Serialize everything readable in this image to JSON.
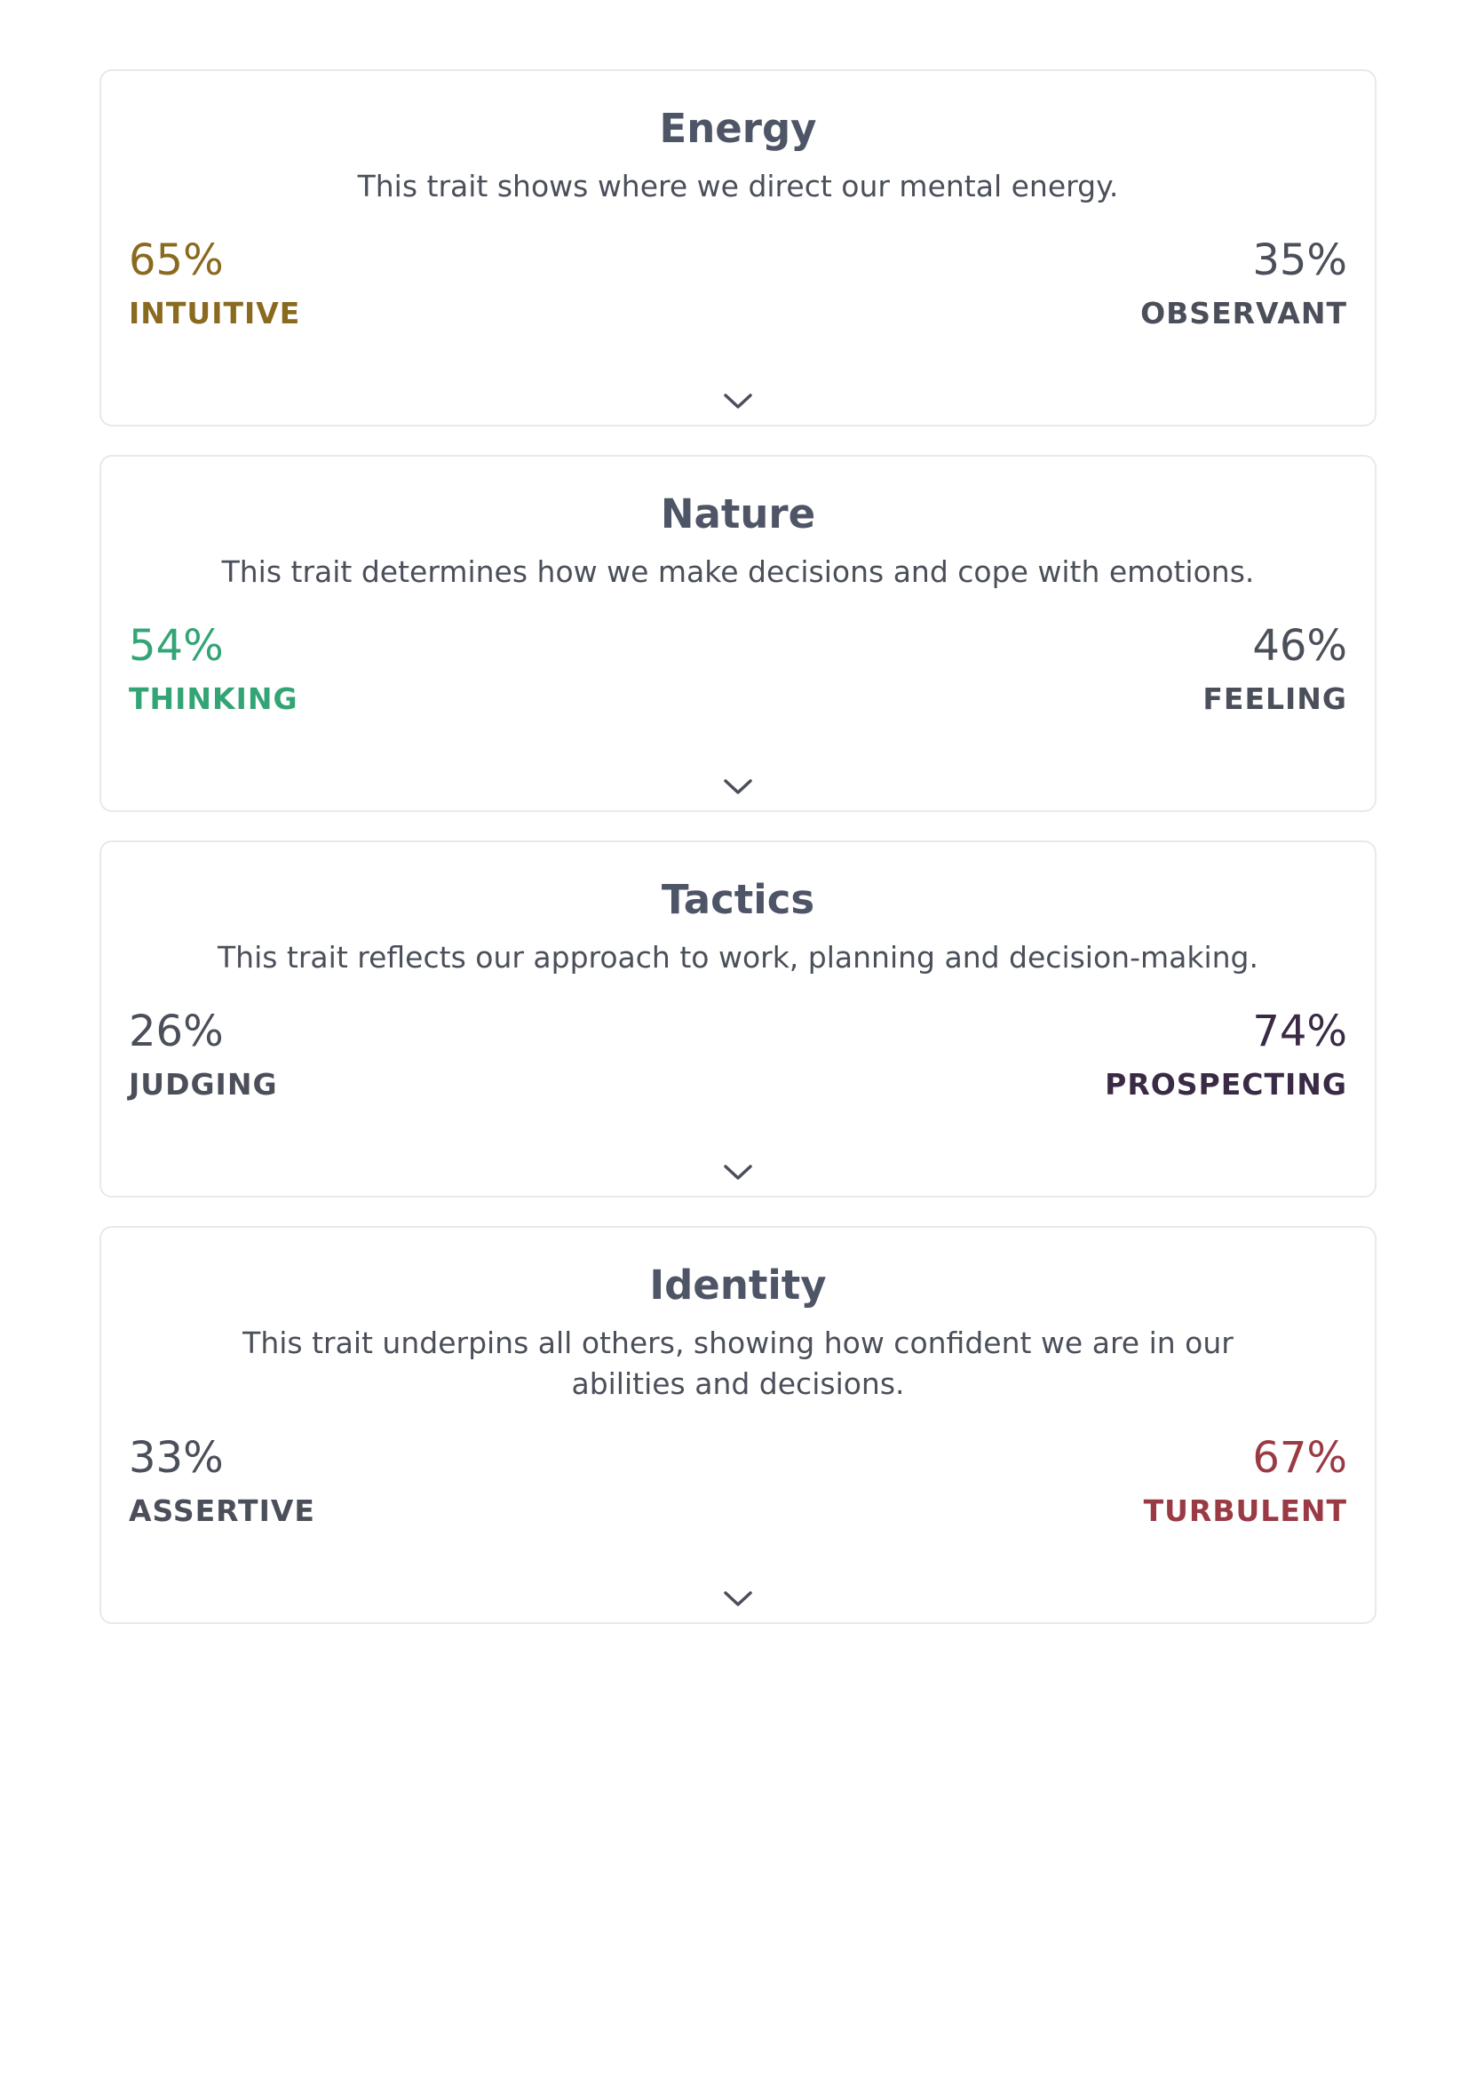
{
  "colors": {
    "intuitive": "#8a6a1f",
    "thinking": "#33a474",
    "prospecting": "#3a2a45",
    "turbulent": "#9a3a44",
    "neutral": "#4a4f5a"
  },
  "traits": [
    {
      "title": "Energy",
      "description": "This trait shows where we direct our mental energy.",
      "left": {
        "percent": "65%",
        "label": "INTUITIVE",
        "color": "#8a6a1f"
      },
      "right": {
        "percent": "35%",
        "label": "OBSERVANT",
        "color": "#4a4f5a"
      },
      "expand_icon": "chevron-down-icon"
    },
    {
      "title": "Nature",
      "description": "This trait determines how we make decisions and cope with emotions.",
      "left": {
        "percent": "54%",
        "label": "THINKING",
        "color": "#33a474"
      },
      "right": {
        "percent": "46%",
        "label": "FEELING",
        "color": "#4a4f5a"
      },
      "expand_icon": "chevron-down-icon"
    },
    {
      "title": "Tactics",
      "description": "This trait reflects our approach to work, planning and decision-making.",
      "left": {
        "percent": "26%",
        "label": "JUDGING",
        "color": "#4a4f5a"
      },
      "right": {
        "percent": "74%",
        "label": "PROSPECTING",
        "color": "#3a2a45"
      },
      "expand_icon": "chevron-down-icon"
    },
    {
      "title": "Identity",
      "description": "This trait underpins all others, showing how confident we are in our abilities and decisions.",
      "left": {
        "percent": "33%",
        "label": "ASSERTIVE",
        "color": "#4a4f5a"
      },
      "right": {
        "percent": "67%",
        "label": "TURBULENT",
        "color": "#9a3a44"
      },
      "expand_icon": "chevron-down-icon"
    }
  ]
}
